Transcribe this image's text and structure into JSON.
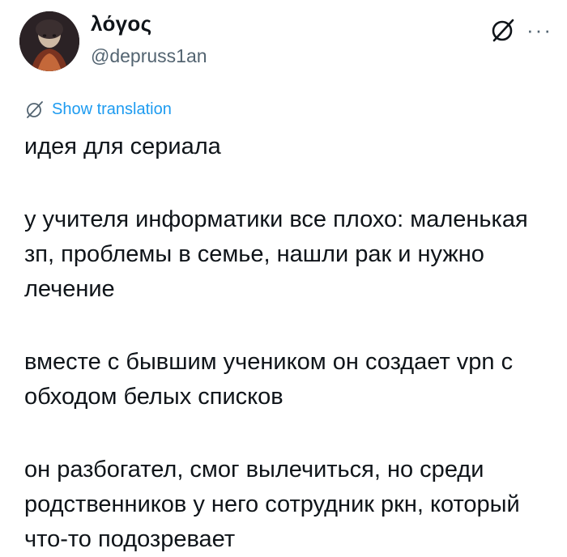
{
  "author": {
    "display_name": "λόγος",
    "handle": "@depruss1an"
  },
  "icons": {
    "avatar": "avatar-image",
    "grok": "grok-icon",
    "more": "more-horizontal-icon",
    "translate": "grok-translate-icon"
  },
  "translation": {
    "label": "Show translation"
  },
  "tweet": {
    "paragraphs": [
      "идея для сериала",
      "у учителя информатики все плохо: маленькая зп, проблемы в семье, нашли рак и нужно лечение",
      "вместе с бывшим учеником он создает vpn с обходом белых списков",
      "он разбогател, смог вылечиться, но среди родственников у него сотрудник ркн, который что-то подозревает"
    ]
  },
  "colors": {
    "text": "#0f1419",
    "secondary": "#536471",
    "link": "#1d9bf0"
  }
}
